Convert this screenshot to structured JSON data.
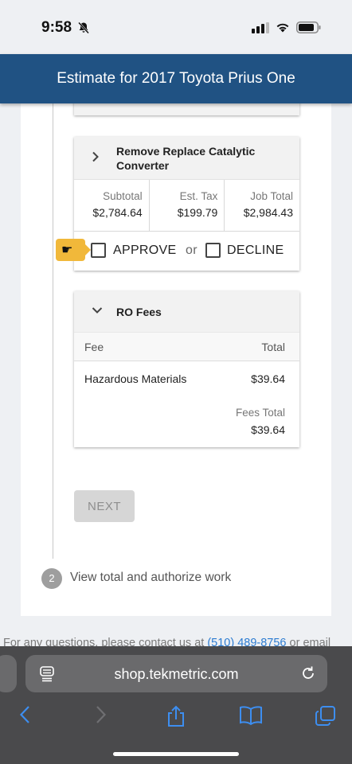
{
  "status_bar": {
    "time": "9:58"
  },
  "header": {
    "title": "Estimate for 2017 Toyota Prius One"
  },
  "job": {
    "title": "Remove Replace Catalytic Converter",
    "subtotal_label": "Subtotal",
    "subtotal": "$2,784.64",
    "tax_label": "Est. Tax",
    "tax": "$199.79",
    "total_label": "Job Total",
    "total": "$2,984.43",
    "approve_label": "APPROVE",
    "or_label": "or",
    "decline_label": "DECLINE"
  },
  "fees": {
    "title": "RO Fees",
    "col_fee": "Fee",
    "col_total": "Total",
    "rows": [
      {
        "name": "Hazardous Materials",
        "amount": "$39.64"
      }
    ],
    "total_label": "Fees Total",
    "total": "$39.64"
  },
  "next_label": "NEXT",
  "step2": {
    "number": "2",
    "label": "View total and authorize work"
  },
  "contact": {
    "text": "For any questions, please contact us at",
    "phone": "(510) 489-8756",
    "suffix": "or email"
  },
  "browser": {
    "url": "shop.tekmetric.com"
  },
  "colors": {
    "header": "#205283",
    "pointer": "#f1b83a",
    "link": "#2b7bd1"
  },
  "icons": [
    "bell-slash-icon",
    "signal-icon",
    "wifi-icon",
    "battery-icon",
    "chevron-right-icon",
    "chevron-down-icon",
    "hand-pointer-icon",
    "page-icon",
    "reload-icon",
    "back-icon",
    "forward-icon",
    "share-icon",
    "bookmarks-icon",
    "tabs-icon"
  ]
}
